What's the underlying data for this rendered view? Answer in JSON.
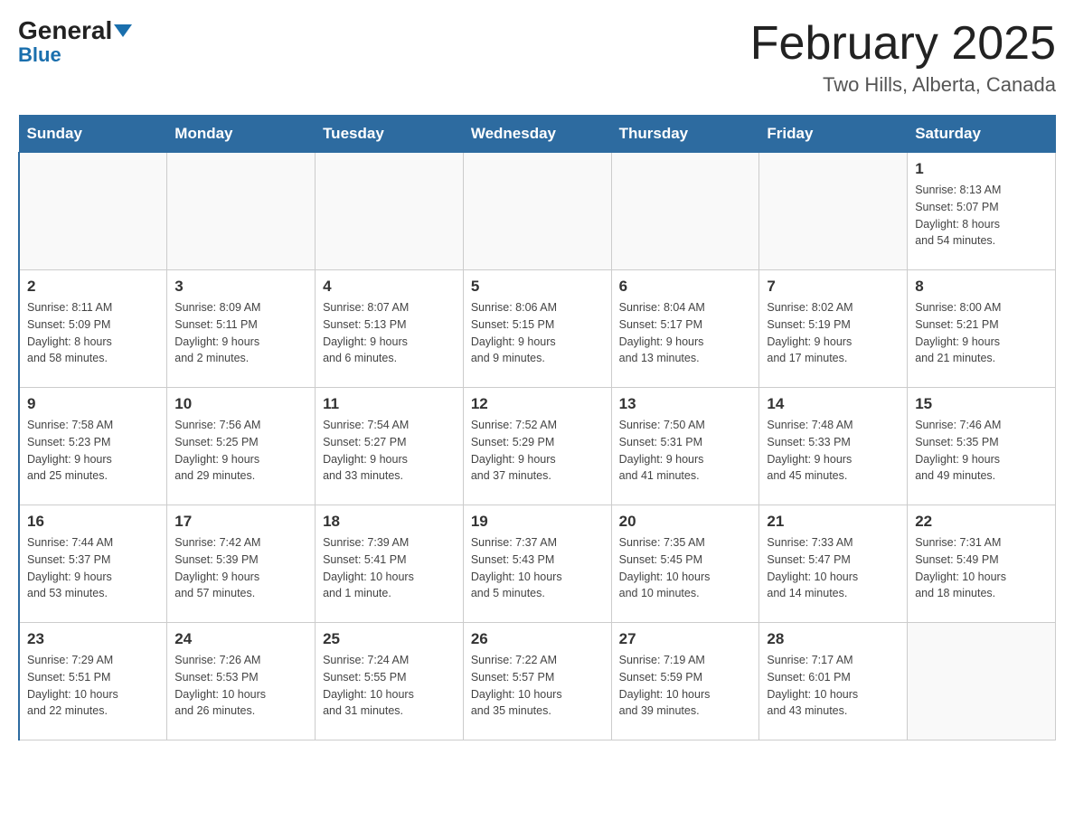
{
  "header": {
    "logo_general": "General",
    "logo_blue": "Blue",
    "calendar_title": "February 2025",
    "calendar_subtitle": "Two Hills, Alberta, Canada"
  },
  "weekdays": [
    "Sunday",
    "Monday",
    "Tuesday",
    "Wednesday",
    "Thursday",
    "Friday",
    "Saturday"
  ],
  "weeks": [
    [
      {
        "day": "",
        "info": ""
      },
      {
        "day": "",
        "info": ""
      },
      {
        "day": "",
        "info": ""
      },
      {
        "day": "",
        "info": ""
      },
      {
        "day": "",
        "info": ""
      },
      {
        "day": "",
        "info": ""
      },
      {
        "day": "1",
        "info": "Sunrise: 8:13 AM\nSunset: 5:07 PM\nDaylight: 8 hours\nand 54 minutes."
      }
    ],
    [
      {
        "day": "2",
        "info": "Sunrise: 8:11 AM\nSunset: 5:09 PM\nDaylight: 8 hours\nand 58 minutes."
      },
      {
        "day": "3",
        "info": "Sunrise: 8:09 AM\nSunset: 5:11 PM\nDaylight: 9 hours\nand 2 minutes."
      },
      {
        "day": "4",
        "info": "Sunrise: 8:07 AM\nSunset: 5:13 PM\nDaylight: 9 hours\nand 6 minutes."
      },
      {
        "day": "5",
        "info": "Sunrise: 8:06 AM\nSunset: 5:15 PM\nDaylight: 9 hours\nand 9 minutes."
      },
      {
        "day": "6",
        "info": "Sunrise: 8:04 AM\nSunset: 5:17 PM\nDaylight: 9 hours\nand 13 minutes."
      },
      {
        "day": "7",
        "info": "Sunrise: 8:02 AM\nSunset: 5:19 PM\nDaylight: 9 hours\nand 17 minutes."
      },
      {
        "day": "8",
        "info": "Sunrise: 8:00 AM\nSunset: 5:21 PM\nDaylight: 9 hours\nand 21 minutes."
      }
    ],
    [
      {
        "day": "9",
        "info": "Sunrise: 7:58 AM\nSunset: 5:23 PM\nDaylight: 9 hours\nand 25 minutes."
      },
      {
        "day": "10",
        "info": "Sunrise: 7:56 AM\nSunset: 5:25 PM\nDaylight: 9 hours\nand 29 minutes."
      },
      {
        "day": "11",
        "info": "Sunrise: 7:54 AM\nSunset: 5:27 PM\nDaylight: 9 hours\nand 33 minutes."
      },
      {
        "day": "12",
        "info": "Sunrise: 7:52 AM\nSunset: 5:29 PM\nDaylight: 9 hours\nand 37 minutes."
      },
      {
        "day": "13",
        "info": "Sunrise: 7:50 AM\nSunset: 5:31 PM\nDaylight: 9 hours\nand 41 minutes."
      },
      {
        "day": "14",
        "info": "Sunrise: 7:48 AM\nSunset: 5:33 PM\nDaylight: 9 hours\nand 45 minutes."
      },
      {
        "day": "15",
        "info": "Sunrise: 7:46 AM\nSunset: 5:35 PM\nDaylight: 9 hours\nand 49 minutes."
      }
    ],
    [
      {
        "day": "16",
        "info": "Sunrise: 7:44 AM\nSunset: 5:37 PM\nDaylight: 9 hours\nand 53 minutes."
      },
      {
        "day": "17",
        "info": "Sunrise: 7:42 AM\nSunset: 5:39 PM\nDaylight: 9 hours\nand 57 minutes."
      },
      {
        "day": "18",
        "info": "Sunrise: 7:39 AM\nSunset: 5:41 PM\nDaylight: 10 hours\nand 1 minute."
      },
      {
        "day": "19",
        "info": "Sunrise: 7:37 AM\nSunset: 5:43 PM\nDaylight: 10 hours\nand 5 minutes."
      },
      {
        "day": "20",
        "info": "Sunrise: 7:35 AM\nSunset: 5:45 PM\nDaylight: 10 hours\nand 10 minutes."
      },
      {
        "day": "21",
        "info": "Sunrise: 7:33 AM\nSunset: 5:47 PM\nDaylight: 10 hours\nand 14 minutes."
      },
      {
        "day": "22",
        "info": "Sunrise: 7:31 AM\nSunset: 5:49 PM\nDaylight: 10 hours\nand 18 minutes."
      }
    ],
    [
      {
        "day": "23",
        "info": "Sunrise: 7:29 AM\nSunset: 5:51 PM\nDaylight: 10 hours\nand 22 minutes."
      },
      {
        "day": "24",
        "info": "Sunrise: 7:26 AM\nSunset: 5:53 PM\nDaylight: 10 hours\nand 26 minutes."
      },
      {
        "day": "25",
        "info": "Sunrise: 7:24 AM\nSunset: 5:55 PM\nDaylight: 10 hours\nand 31 minutes."
      },
      {
        "day": "26",
        "info": "Sunrise: 7:22 AM\nSunset: 5:57 PM\nDaylight: 10 hours\nand 35 minutes."
      },
      {
        "day": "27",
        "info": "Sunrise: 7:19 AM\nSunset: 5:59 PM\nDaylight: 10 hours\nand 39 minutes."
      },
      {
        "day": "28",
        "info": "Sunrise: 7:17 AM\nSunset: 6:01 PM\nDaylight: 10 hours\nand 43 minutes."
      },
      {
        "day": "",
        "info": ""
      }
    ]
  ]
}
